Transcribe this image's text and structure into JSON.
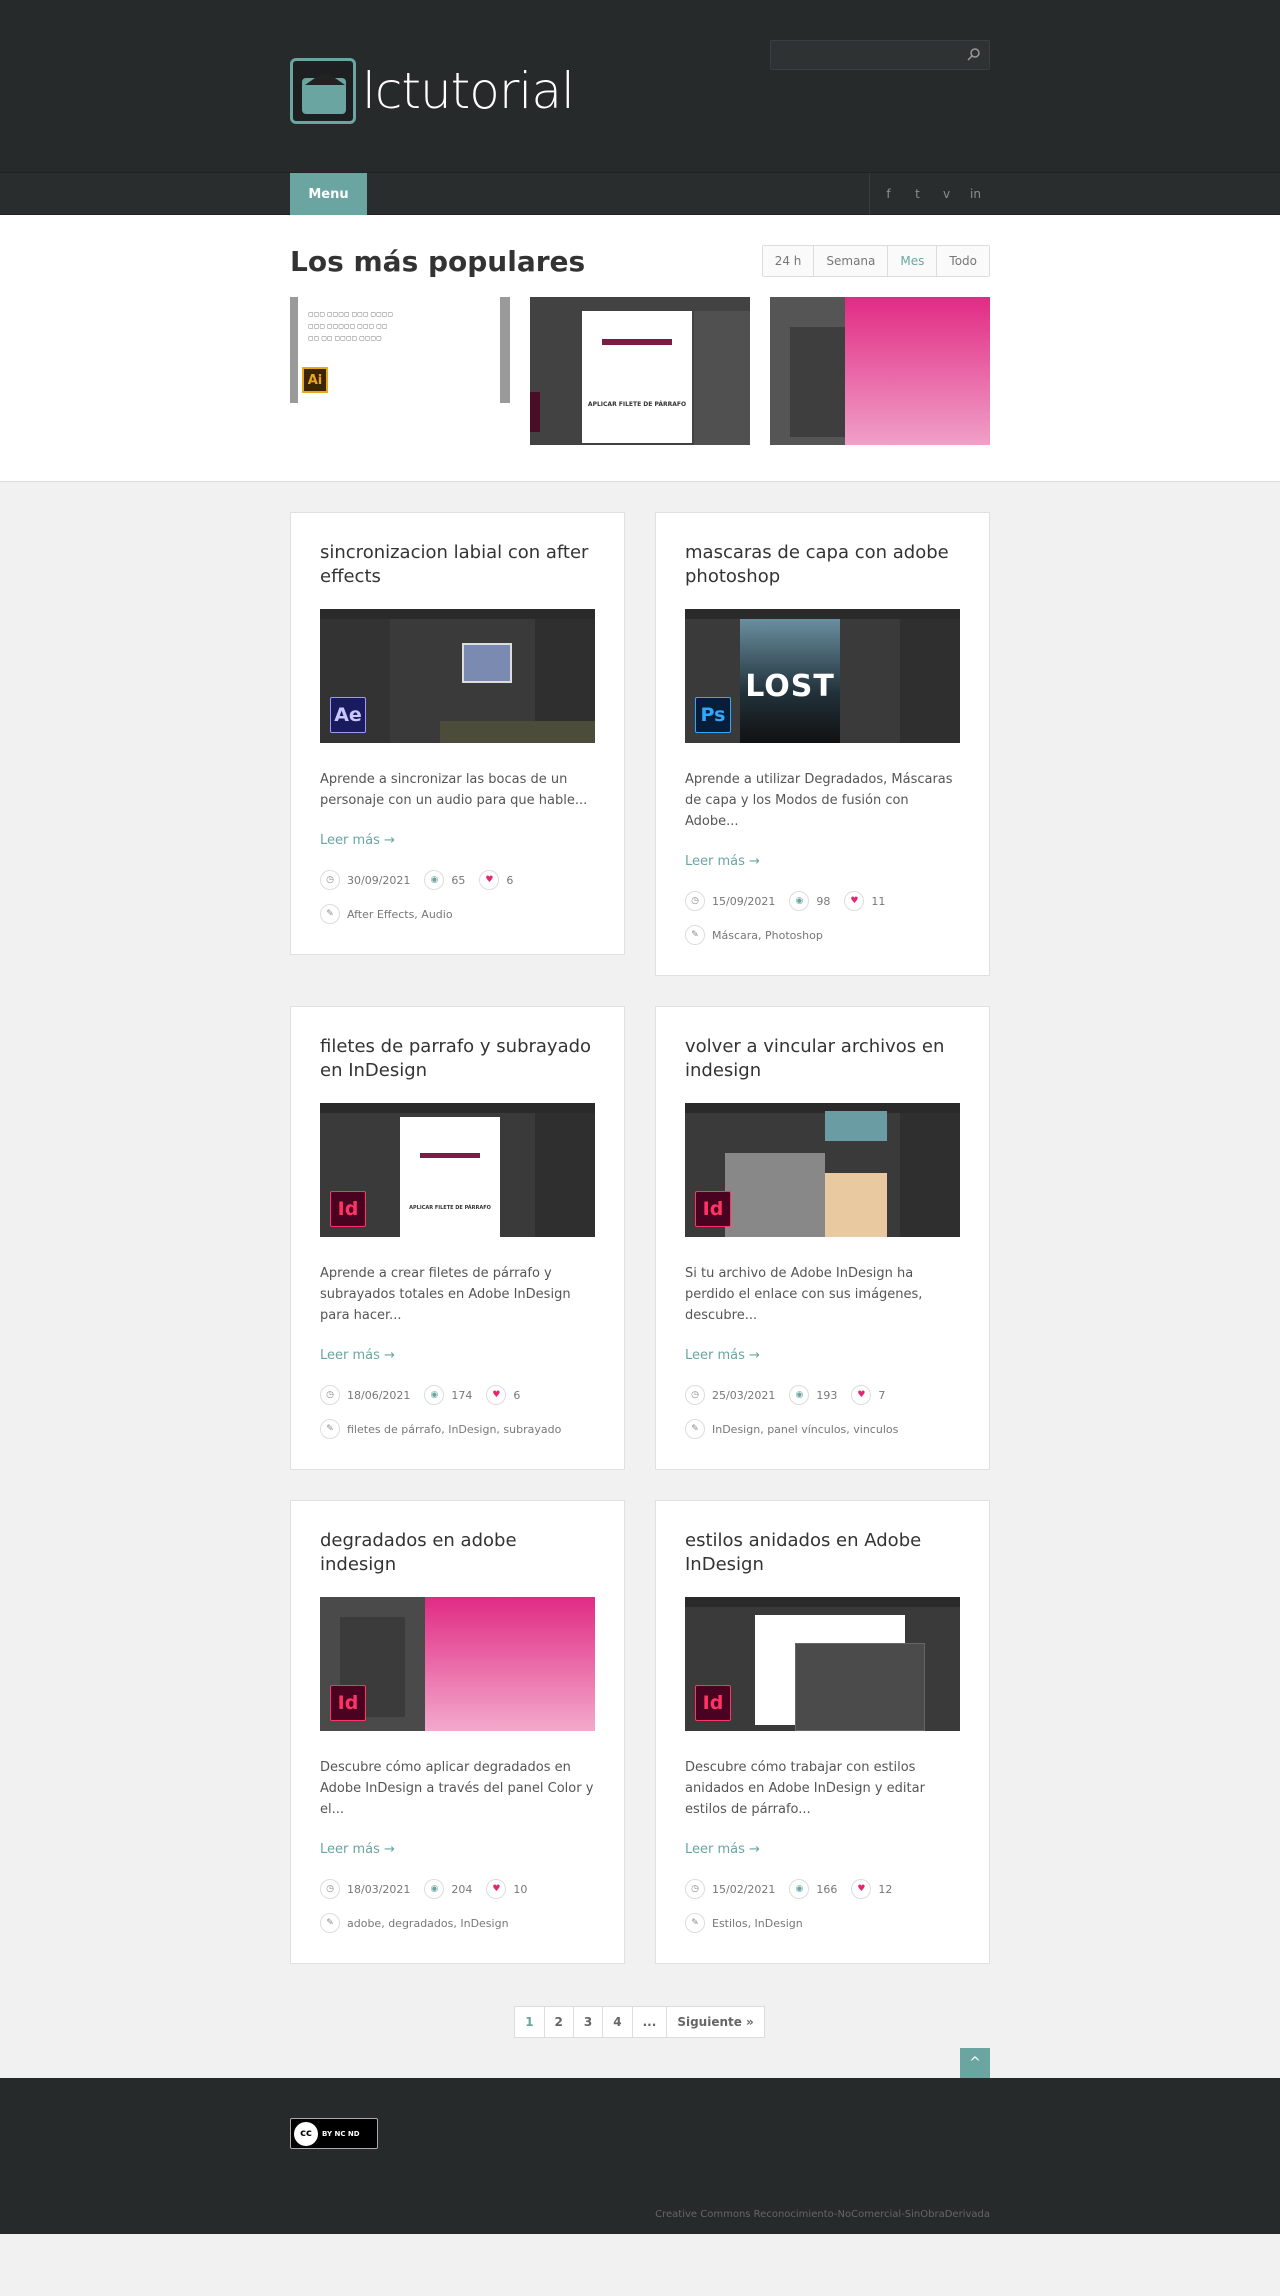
{
  "header": {
    "logo_text": "lctutorial",
    "search_placeholder": ""
  },
  "nav": {
    "menu_label": "Menu",
    "social": [
      "f",
      "t",
      "v",
      "in"
    ]
  },
  "popular": {
    "title": "Los más populares",
    "tabs": [
      "24 h",
      "Semana",
      "Mes",
      "Todo"
    ],
    "active_tab": "Mes",
    "thumb1_badge": "Ai",
    "thumb2_caption": "APLICAR FILETE DE PÁRRAFO"
  },
  "read_more": "Leer más →",
  "posts": [
    {
      "title": "sincronizacion labial con after effects",
      "excerpt": "Aprende a sincronizar las bocas de un personaje con un audio para que hable...",
      "date": "30/09/2021",
      "views": "65",
      "likes": "6",
      "tags": "After Effects, Audio",
      "badge": "Ae"
    },
    {
      "title": "mascaras de capa con adobe photoshop",
      "excerpt": "Aprende a utilizar Degradados, Máscaras de capa y los Modos de fusión con Adobe...",
      "date": "15/09/2021",
      "views": "98",
      "likes": "11",
      "tags": "Máscara, Photoshop",
      "badge": "Ps",
      "poster_text": "LOST"
    },
    {
      "title": "filetes de parrafo y subrayado en InDesign",
      "excerpt": "Aprende a crear filetes de párrafo y subrayados totales en Adobe InDesign para hacer...",
      "date": "18/06/2021",
      "views": "174",
      "likes": "6",
      "tags": "filetes de párrafo, InDesign, subrayado",
      "badge": "Id",
      "doc_caption": "APLICAR FILETE DE PÁRRAFO"
    },
    {
      "title": "volver a vincular archivos en indesign",
      "excerpt": "Si tu archivo de Adobe InDesign ha perdido el enlace con sus imágenes, descubre...",
      "date": "25/03/2021",
      "views": "193",
      "likes": "7",
      "tags": "InDesign, panel vínculos, vinculos",
      "badge": "Id"
    },
    {
      "title": "degradados en adobe indesign",
      "excerpt": "Descubre cómo aplicar degradados en Adobe InDesign a través del panel Color y el...",
      "date": "18/03/2021",
      "views": "204",
      "likes": "10",
      "tags": "adobe, degradados, InDesign",
      "badge": "Id"
    },
    {
      "title": "estilos anidados en Adobe InDesign",
      "excerpt": "Descubre cómo trabajar con estilos anidados en Adobe InDesign y editar estilos de párrafo...",
      "date": "15/02/2021",
      "views": "166",
      "likes": "12",
      "tags": "Estilos, InDesign",
      "badge": "Id"
    }
  ],
  "pagination": [
    "1",
    "2",
    "3",
    "4",
    "...",
    "Siguiente »"
  ],
  "to_top": "^",
  "footer": {
    "cc_badge": "cc",
    "cc_small": "BY  NC  ND",
    "license": "Creative Commons Reconocimiento-NoComercial-SinObraDerivada"
  },
  "colors": {
    "accent": "#6aa5a2",
    "header_bg": "#272a2b",
    "heart": "#e2276f"
  }
}
